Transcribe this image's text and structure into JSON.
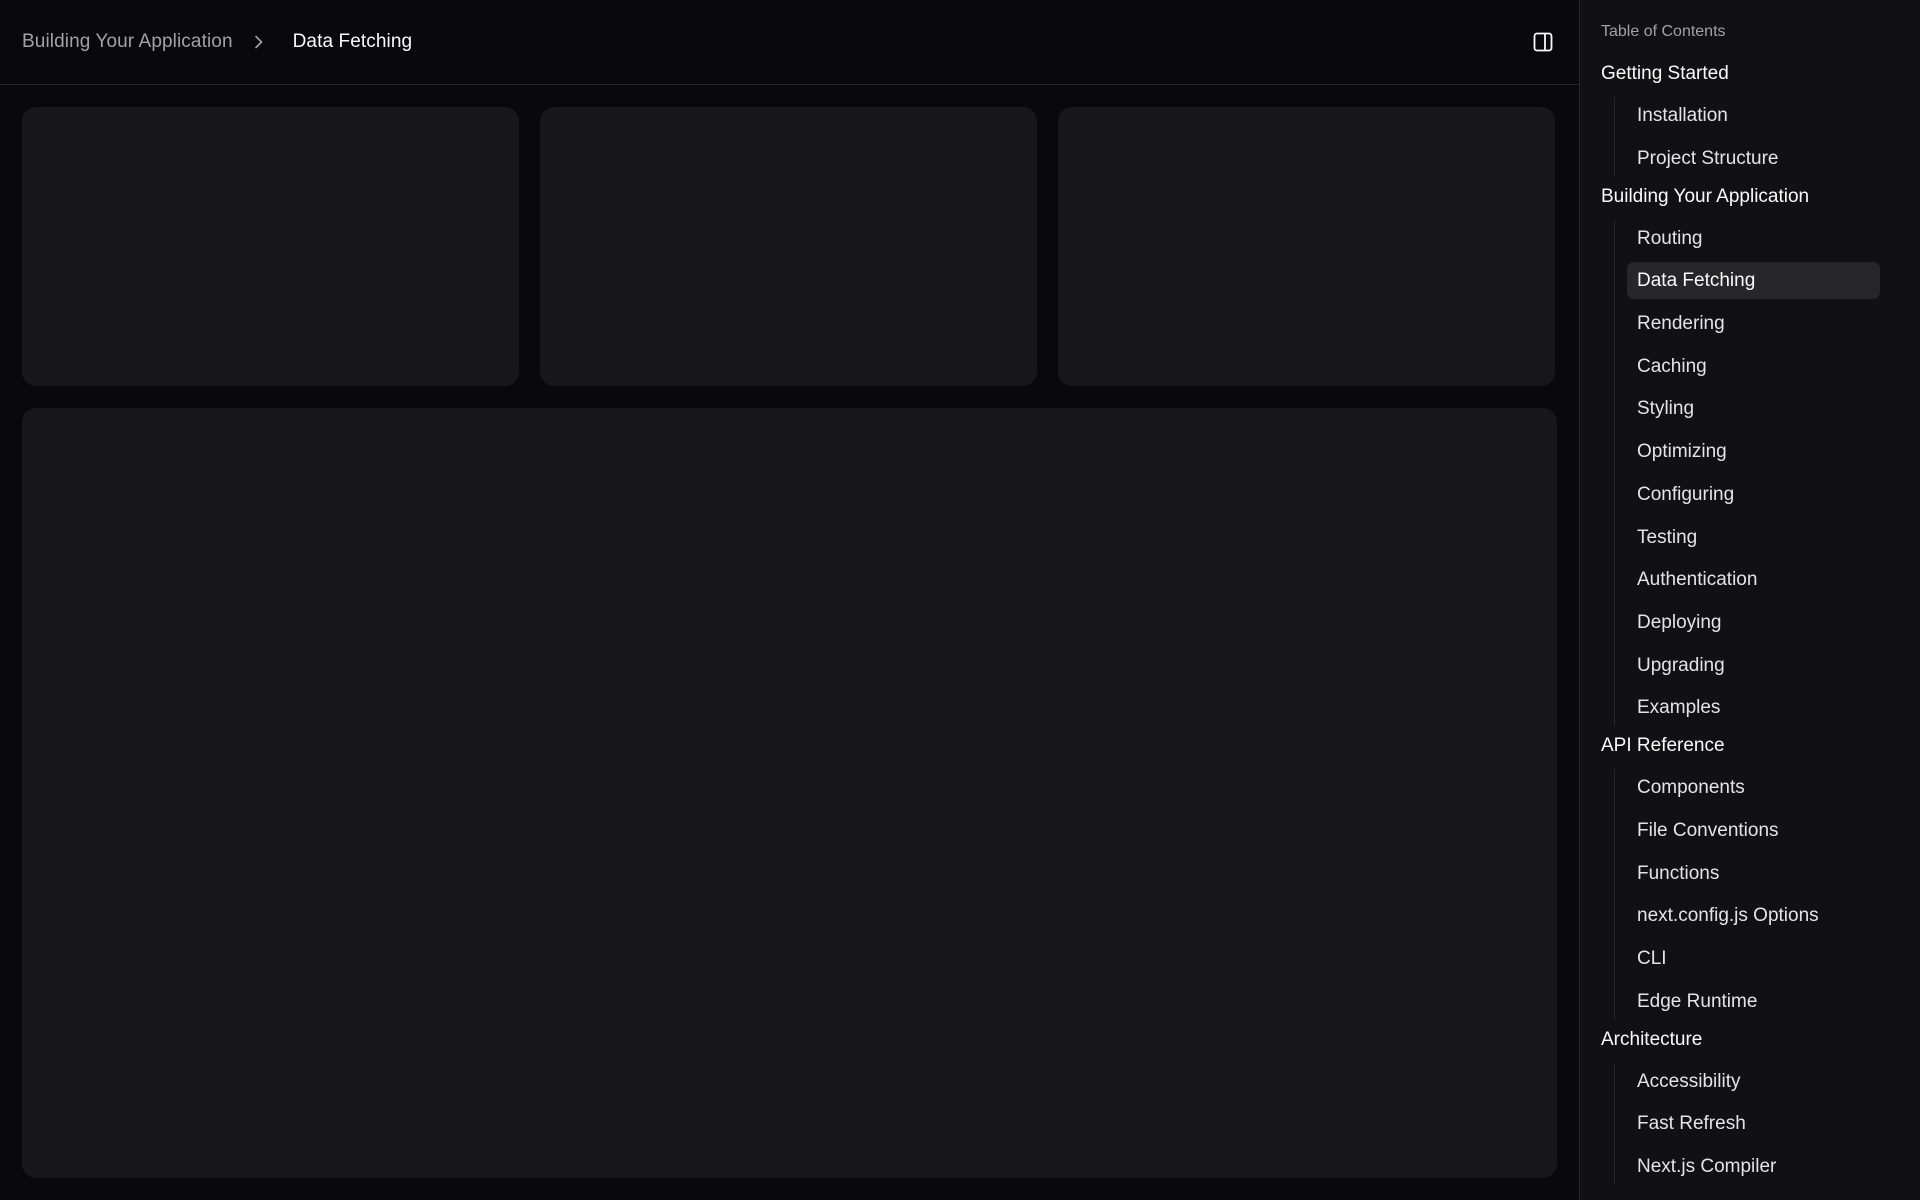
{
  "breadcrumb": {
    "parent": "Building Your Application",
    "current": "Data Fetching"
  },
  "icons": {
    "separator": "chevron-right-icon",
    "panel_toggle": "panel-right-icon"
  },
  "colors": {
    "background": "#09090b",
    "card": "#18181b",
    "sidebar": "#111113",
    "active_item": "#27272a",
    "muted_text": "#a1a1aa"
  },
  "toc": {
    "title": "Table of Contents",
    "sections": [
      {
        "title": "Getting Started",
        "items": [
          "Installation",
          "Project Structure"
        ]
      },
      {
        "title": "Building Your Application",
        "items": [
          "Routing",
          "Data Fetching",
          "Rendering",
          "Caching",
          "Styling",
          "Optimizing",
          "Configuring",
          "Testing",
          "Authentication",
          "Deploying",
          "Upgrading",
          "Examples"
        ]
      },
      {
        "title": "API Reference",
        "items": [
          "Components",
          "File Conventions",
          "Functions",
          "next.config.js Options",
          "CLI",
          "Edge Runtime"
        ]
      },
      {
        "title": "Architecture",
        "items": [
          "Accessibility",
          "Fast Refresh",
          "Next.js Compiler"
        ]
      }
    ],
    "active_item": "Data Fetching"
  }
}
